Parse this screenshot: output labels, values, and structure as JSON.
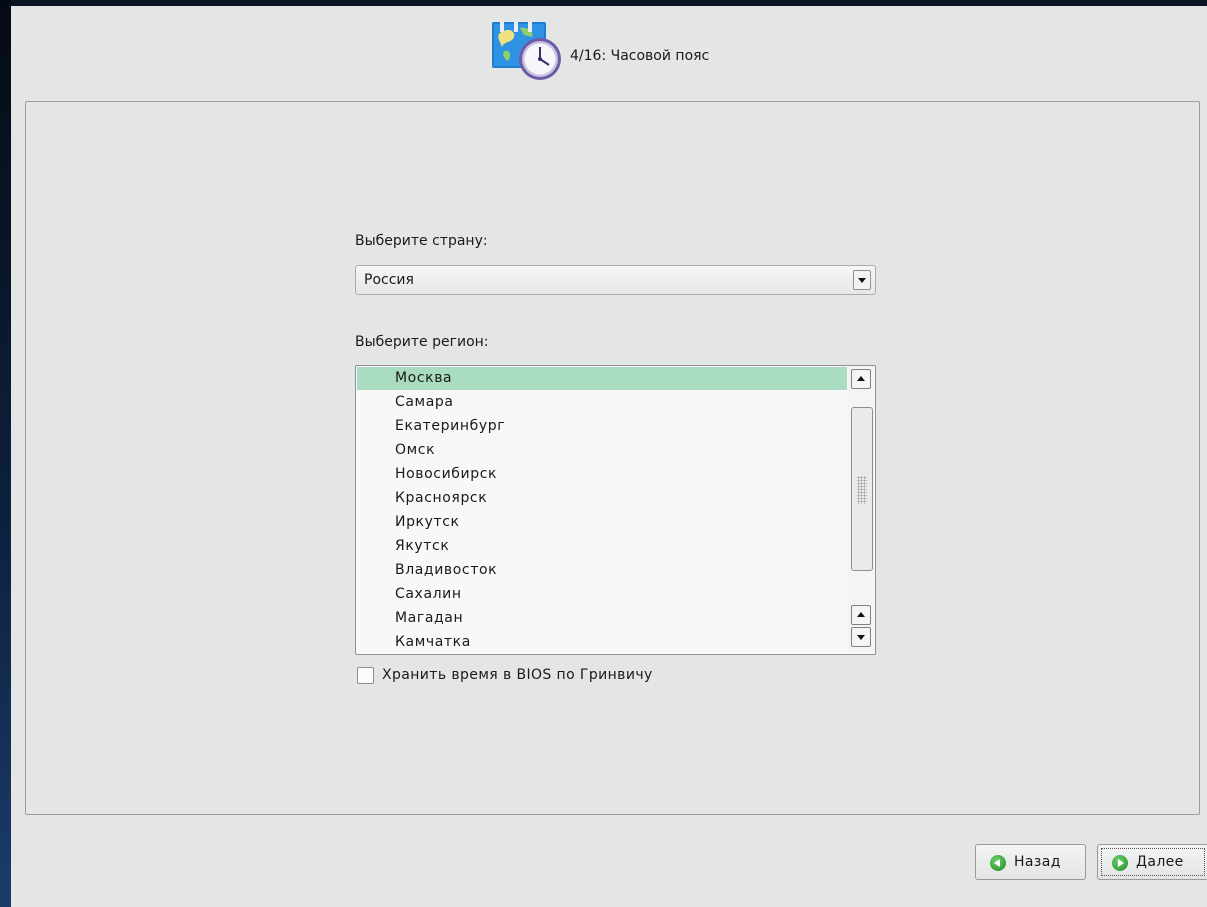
{
  "header": {
    "title": "4/16: Часовой пояс",
    "icon": "timezone-clock-icon"
  },
  "country": {
    "label": "Выберите страну:",
    "selected": "Россия"
  },
  "region": {
    "label": "Выберите регион:",
    "items": [
      "Москва",
      "Самара",
      "Екатеринбург",
      "Омск",
      "Новосибирск",
      "Красноярск",
      "Иркутск",
      "Якутск",
      "Владивосток",
      "Сахалин",
      "Магадан",
      "Камчатка"
    ],
    "selected_index": 0
  },
  "bios_checkbox": {
    "label": "Хранить время в BIOS по Гринвичу",
    "checked": false
  },
  "footer": {
    "back_label": "Назад",
    "next_label": "Далее"
  },
  "colors": {
    "selection": "#a9dcc0",
    "window_bg": "#e3e6e4",
    "button_icon": "#2e9a32"
  }
}
